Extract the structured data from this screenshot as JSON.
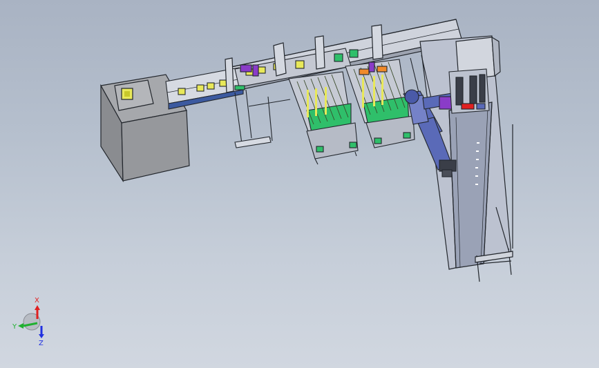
{
  "viewport": {
    "background_top": "#a9b3c3",
    "background_bottom": "#d1d7e0"
  },
  "model": {
    "frame_color": "#22262c",
    "panel_color": "#c8ccd6",
    "hopper_color": "#8f9196",
    "conveyor_blue": "#3c5aa0",
    "robot_color": "#5a6ab8",
    "turntable_green": "#2fbf6a",
    "part_yellow": "#e8e85a",
    "accent_purple": "#8a3cc8",
    "accent_orange": "#f08a2a"
  },
  "triad": {
    "x_label": "X",
    "y_label": "Y",
    "z_label": "Z",
    "x_color": "#e02020",
    "y_color": "#20b030",
    "z_color": "#2030e0"
  }
}
